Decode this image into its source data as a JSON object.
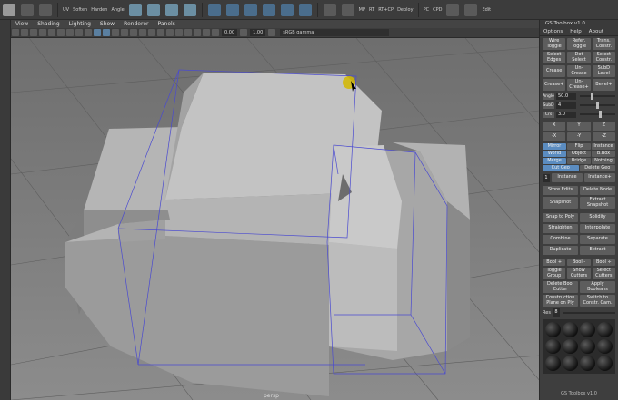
{
  "shelf": {
    "labels": [
      "UV",
      "Soften",
      "Harden",
      "Angle",
      "MP",
      "RT",
      "RT+CP",
      "Deploy",
      "PC",
      "CPD",
      "Edit"
    ]
  },
  "viewport_menu": [
    "View",
    "Shading",
    "Lighting",
    "Show",
    "Renderer",
    "Panels"
  ],
  "viewport_toolbar": {
    "field1": "0.00",
    "field2": "1.00",
    "colorspace": "sRGB gamma"
  },
  "viewport": {
    "camera_label": "persp"
  },
  "panel": {
    "title": "GS Toolbox v1.0",
    "tabs": [
      "Options",
      "Help",
      "About"
    ],
    "row1": [
      "Wire\nToggle",
      "Refer.\nToggle",
      "Trans.\nConstr."
    ],
    "row2": [
      "Select\nEdges",
      "Dot\nSelect",
      "Select\nConstr."
    ],
    "row3": [
      "Crease",
      "Un-\nCrease",
      "SubD\nLevel"
    ],
    "row4": [
      "Crease+",
      "Un-\nCrease+",
      "Bevel+"
    ],
    "sliders": [
      {
        "label": "Angle",
        "value": "50.0",
        "position": 0.3
      },
      {
        "label": "SubD",
        "value": "4",
        "position": 0.45
      },
      {
        "label": "Crs",
        "value": "3.0",
        "position": 0.55
      }
    ],
    "axis_row1": [
      "X",
      "Y",
      "Z"
    ],
    "axis_row2": [
      "-X",
      "-Y",
      "-Z"
    ],
    "mirror_row1": [
      "Mirror",
      "Flip",
      "Instance"
    ],
    "mirror_row2": [
      "World",
      "Object",
      "B.Box"
    ],
    "mirror_row3": [
      "Merge",
      "Bridge",
      "Nothing"
    ],
    "mirror_row4": [
      "Cut Geo",
      "Delete Geo"
    ],
    "instance_field": "1",
    "instance_buttons": [
      "Instance",
      "Instance+"
    ],
    "store_row": [
      "Store Edits",
      "Delete Node"
    ],
    "snap_row": [
      "Snapshot",
      "Extract\nSnapshot"
    ],
    "poly_row": [
      "Snap to Poly",
      "Solidify"
    ],
    "straighten_row": [
      "Straighten",
      "Interpolate"
    ],
    "combine_row": [
      "Combine",
      "Separate"
    ],
    "duplicate_row": [
      "Duplicate",
      "Extract"
    ],
    "bool_row": [
      "Bool +",
      "Bool -",
      "Bool ÷"
    ],
    "toggle_row": [
      "Toggle\nGroup",
      "Show\nCutters",
      "Select\nCutters"
    ],
    "delete_row": [
      "Delete Bool\nCutter",
      "Apply\nBooleans"
    ],
    "construct_row": [
      "Construction\nPlane on Ply",
      "Switch to\nConstr. Cam."
    ],
    "res_label": "Res",
    "res_value": "8",
    "footer": "GS Toolbox v1.0"
  },
  "colors": {
    "accent_blue": "#5b8cc0",
    "panel_bg": "#3e3e3e",
    "viewport_bg": "#7a7a7a"
  }
}
